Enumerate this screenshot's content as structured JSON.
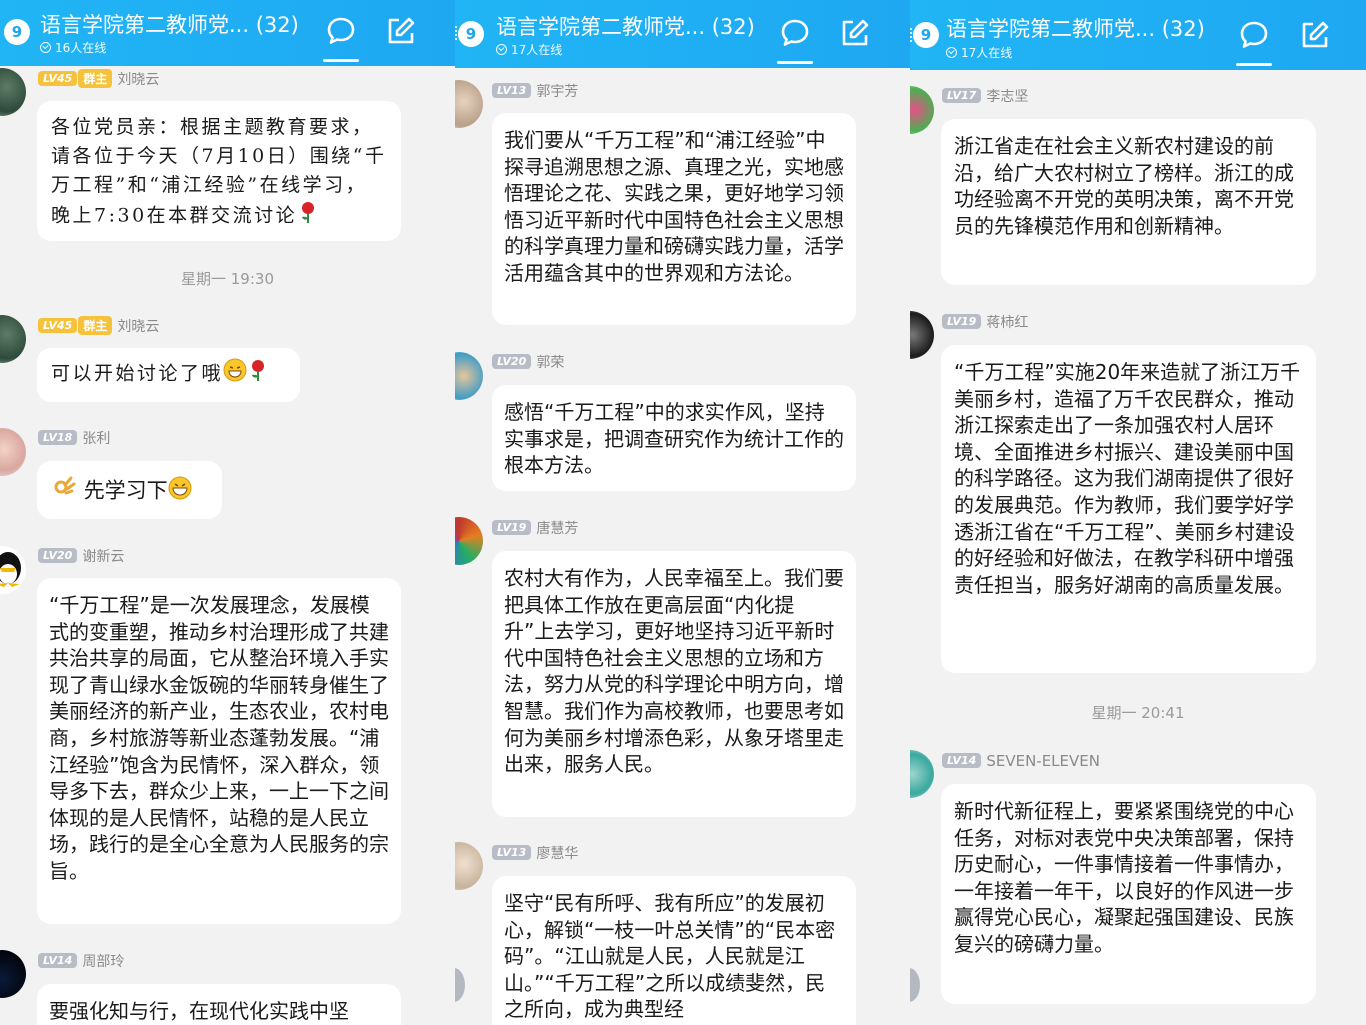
{
  "panels": [
    {
      "header": {
        "badge": "9",
        "title": "语言学院第二教师党... (32)",
        "online": "16人在线"
      },
      "timestamp": "星期一 19:30",
      "messages": [
        {
          "lv": "LV45",
          "role": "群主",
          "name": "刘晓云",
          "text": "各位党员亲：根据主题教育要求，请各位于今天（7月10日）围绕“千万工程”和“浦江经验”在线学习，晚上7:30在本群交流讨论"
        },
        {
          "lv": "LV45",
          "role": "群主",
          "name": "刘晓云",
          "text": "可以开始讨论了哦"
        },
        {
          "lv": "LV18",
          "name": "张利",
          "text": "先学习下"
        },
        {
          "lv": "LV20",
          "name": "谢新云",
          "text": "“千万工程”是一次发展理念，发展模式的变重塑，推动乡村治理形成了共建共治共享的局面，它从整治环境入手实现了青山绿水金饭碗的华丽转身催生了美丽经济的新产业，生态农业，农村电商，乡村旅游等新业态蓬勃发展。“浦江经验”饱含为民情怀，深入群众，领导多下去，群众少上来，一上一下之间体现的是人民情怀，站稳的是人民立场，践行的是全心全意为人民服务的宗旨。"
        },
        {
          "lv": "LV14",
          "name": "周部玲",
          "text": "要强化知与行，在现代化实践中坚"
        }
      ]
    },
    {
      "header": {
        "badge": "9",
        "title": "语言学院第二教师党... (32)",
        "online": "17人在线"
      },
      "messages": [
        {
          "lv": "LV13",
          "name": "郭宇芳",
          "text": "我们要从“千万工程”和“浦江经验”中探寻追溯思想之源、真理之光，实地感悟理论之花、实践之果，更好地学习领悟习近平新时代中国特色社会主义思想的科学真理力量和磅礴实践力量，活学活用蕴含其中的世界观和方法论。"
        },
        {
          "lv": "LV20",
          "name": "郭荣",
          "text": "感悟“千万工程”中的求实作风，坚持实事求是，把调查研究作为统计工作的根本方法。"
        },
        {
          "lv": "LV19",
          "name": "唐慧芳",
          "text": "农村大有作为，人民幸福至上。我们要把具体工作放在更高层面“内化提升”上去学习，更好地坚持习近平新时代中国特色社会主义思想的立场和方法，努力从党的科学理论中明方向，增智慧。我们作为高校教师，也要思考如何为美丽乡村增添色彩，从象牙塔里走出来，服务人民。"
        },
        {
          "lv": "LV13",
          "name": "廖慧华",
          "text": "坚守“民有所呼、我有所应”的发展初心，解锁“一枝一叶总关情”的“民本密码”。“江山就是人民，人民就是江山。”“千万工程”之所以成绩斐然，民之所向，成为典型经"
        }
      ]
    },
    {
      "header": {
        "badge": "9",
        "title": "语言学院第二教师党... (32)",
        "online": "17人在线"
      },
      "timestamp": "星期一 20:41",
      "messages": [
        {
          "lv": "LV17",
          "name": "李志坚",
          "text": "浙江省走在社会主义新农村建设的前沿，给广大农村树立了榜样。浙江的成功经验离不开党的英明决策，离不开党员的先锋模范作用和创新精神。"
        },
        {
          "lv": "LV19",
          "name": "蒋柿红",
          "text": "“千万工程”实施20年来造就了浙江万千美丽乡村，造福了万千农民群众，推动浙江探索走出了一条加强农村人居环境、全面推进乡村振兴、建设美丽中国的科学路径。这为我们湖南提供了很好的发展典范。作为教师，我们要学好学透浙江省在“千万工程”、美丽乡村建设的好经验和好做法，在教学科研中增强责任担当，服务好湖南的高质量发展。"
        },
        {
          "lv": "LV14",
          "name": "SEVEN-ELEVEN",
          "text": "新时代新征程上，要紧紧围绕党的中心任务，对标对表党中央决策部署，保持历史耐心，一件事情接着一件事情办，一年接着一年干，以良好的作风进一步赢得党心民心，凝聚起强国建设、民族复兴的磅礴力量。"
        }
      ]
    }
  ],
  "colors": {
    "header": "#1ea8f2",
    "bubble": "#ffffff",
    "background": "#f2f2f2",
    "level_gold": "#f7c23b",
    "level_gray": "#b7bcc6"
  },
  "icons": [
    "chat-icon",
    "edit-icon",
    "rose-emoji",
    "grin-emoji",
    "ok-hand-emoji"
  ]
}
